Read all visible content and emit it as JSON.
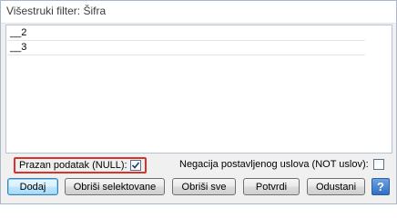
{
  "window": {
    "title": "Višestruki filter: Šifra"
  },
  "list": {
    "items": [
      {
        "label": "__2"
      },
      {
        "label": "__3"
      }
    ]
  },
  "options": {
    "null_label": "Prazan podatak (NULL):",
    "null_checked": true,
    "negate_label": "Negacija postavljenog uslova (NOT uslov):",
    "negate_checked": false
  },
  "buttons": {
    "add": "Dodaj",
    "delete_selected": "Obriši selektovane",
    "delete_all": "Obriši sve",
    "confirm": "Potvrdi",
    "cancel": "Odustani",
    "help": "?"
  },
  "colors": {
    "highlight_border": "#d9342b",
    "help_button": "#2f6fc3"
  }
}
